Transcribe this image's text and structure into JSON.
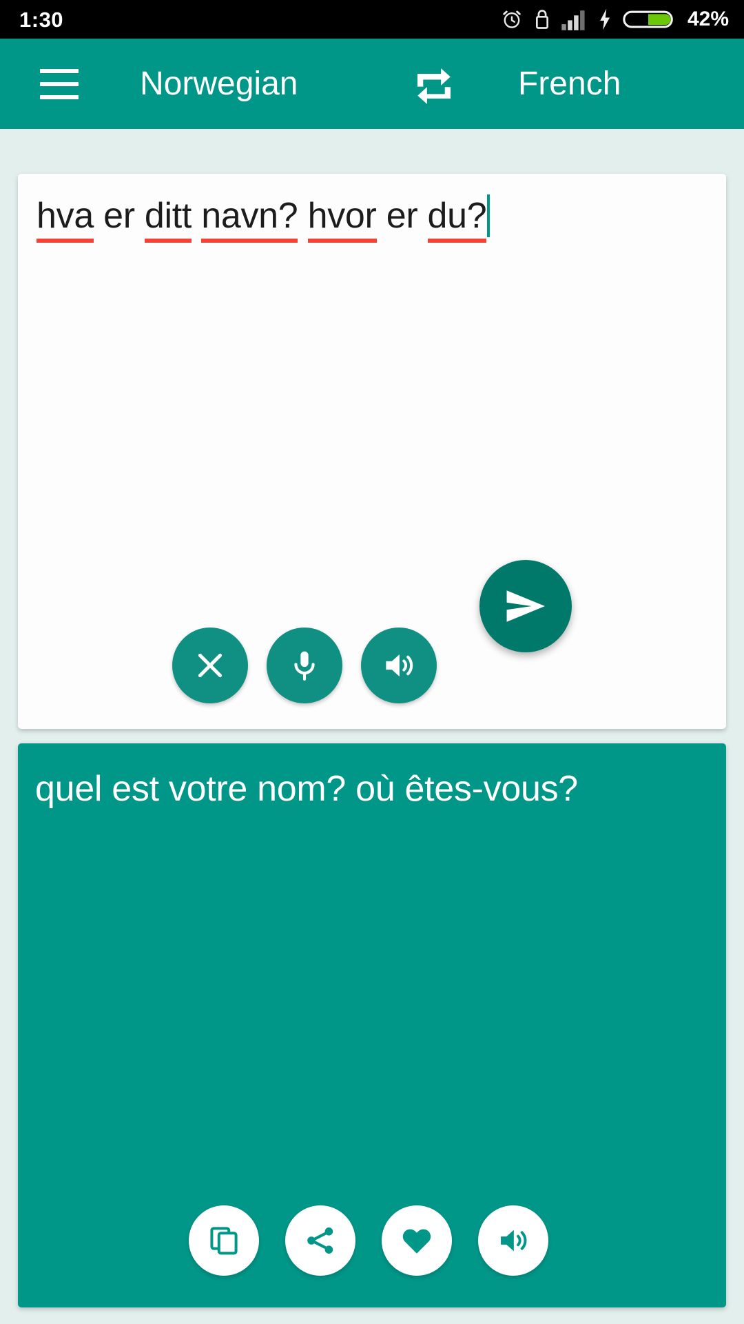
{
  "status_bar": {
    "time": "1:30",
    "battery_percent": "42%",
    "icons": [
      "alarm-clock-icon",
      "lock-icon",
      "signal-bars-icon",
      "charging-bolt-icon",
      "battery-icon"
    ]
  },
  "app_bar": {
    "menu_icon": "hamburger-menu-icon",
    "source_language": "Norwegian",
    "swap_icon": "swap-languages-icon",
    "target_language": "French"
  },
  "source_panel": {
    "text": "hva er ditt navn? hvor er du?",
    "tokens": [
      {
        "text": "hva",
        "misspelled": true
      },
      {
        "text": " ",
        "misspelled": false
      },
      {
        "text": "er",
        "misspelled": false
      },
      {
        "text": " ",
        "misspelled": false
      },
      {
        "text": "ditt",
        "misspelled": true
      },
      {
        "text": " ",
        "misspelled": false
      },
      {
        "text": "navn?",
        "misspelled": true
      },
      {
        "text": " ",
        "misspelled": false
      },
      {
        "text": "hvor",
        "misspelled": true
      },
      {
        "text": " ",
        "misspelled": false
      },
      {
        "text": "er",
        "misspelled": false
      },
      {
        "text": " ",
        "misspelled": false
      },
      {
        "text": "du?",
        "misspelled": true
      }
    ],
    "actions": [
      {
        "name": "clear-button",
        "icon": "close-icon"
      },
      {
        "name": "voice-input-button",
        "icon": "microphone-icon"
      },
      {
        "name": "speak-source-button",
        "icon": "speaker-icon"
      }
    ]
  },
  "send_button": {
    "name": "translate-send-button",
    "icon": "send-icon"
  },
  "target_panel": {
    "text": "quel est votre nom? où êtes-vous?",
    "actions": [
      {
        "name": "copy-button",
        "icon": "copy-icon"
      },
      {
        "name": "share-button",
        "icon": "share-icon"
      },
      {
        "name": "favorite-button",
        "icon": "heart-icon"
      },
      {
        "name": "speak-target-button",
        "icon": "speaker-icon"
      }
    ]
  },
  "colors": {
    "primary": "#009688",
    "primary_dark": "#00796b",
    "fab_teal": "#0f9083",
    "background": "#e2efec",
    "card_white": "#fdfdfd",
    "spellcheck_red": "#f44336",
    "battery_green": "#6cc70a",
    "status_bar_bg": "#000000"
  }
}
